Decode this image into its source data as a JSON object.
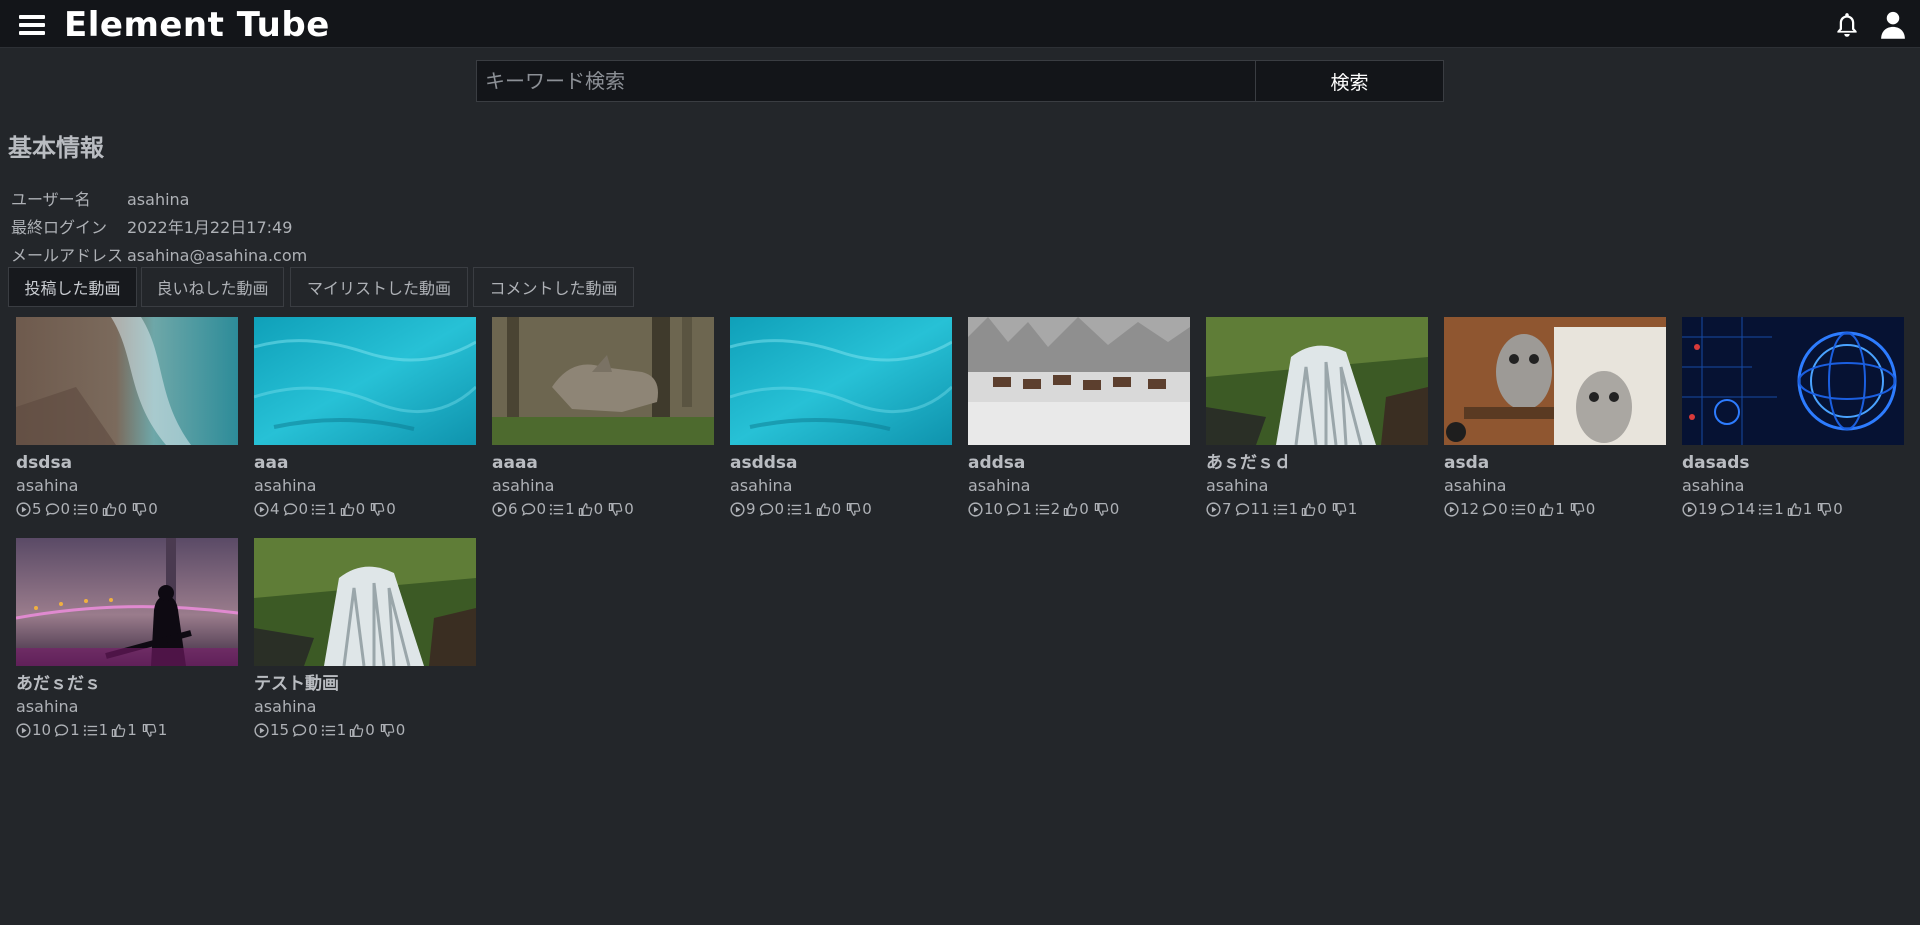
{
  "app": {
    "title": "Element Tube"
  },
  "header": {
    "menu_icon": "hamburger-menu-icon",
    "bell_icon": "bell-icon",
    "user_icon": "user-icon"
  },
  "search": {
    "placeholder": "キーワード検索",
    "value": "",
    "button_label": "検索"
  },
  "profile": {
    "section_title": "基本情報",
    "rows": [
      {
        "label": "ユーザー名",
        "value": "asahina"
      },
      {
        "label": "最終ログイン",
        "value": "2022年1月22日17:49"
      },
      {
        "label": "メールアドレス",
        "value": "asahina@asahina.com"
      }
    ]
  },
  "tabs": [
    {
      "label": "投稿した動画",
      "active": true
    },
    {
      "label": "良いねした動画",
      "active": false
    },
    {
      "label": "マイリストした動画",
      "active": false
    },
    {
      "label": "コメントした動画",
      "active": false
    }
  ],
  "videos": [
    {
      "title": "dsdsa",
      "author": "asahina",
      "plays": "5",
      "comments": "0",
      "mylists": "0",
      "likes": "0",
      "dislikes": "0",
      "thumb": "coast-aerial"
    },
    {
      "title": "aaa",
      "author": "asahina",
      "plays": "4",
      "comments": "0",
      "mylists": "1",
      "likes": "0",
      "dislikes": "0",
      "thumb": "turquoise-water"
    },
    {
      "title": "aaaa",
      "author": "asahina",
      "plays": "6",
      "comments": "0",
      "mylists": "1",
      "likes": "0",
      "dislikes": "0",
      "thumb": "wolf-forest"
    },
    {
      "title": "asddsa",
      "author": "asahina",
      "plays": "9",
      "comments": "0",
      "mylists": "1",
      "likes": "0",
      "dislikes": "0",
      "thumb": "turquoise-water"
    },
    {
      "title": "addsa",
      "author": "asahina",
      "plays": "10",
      "comments": "1",
      "mylists": "2",
      "likes": "0",
      "dislikes": "0",
      "thumb": "deer-snow"
    },
    {
      "title": "あｓだｓｄ",
      "author": "asahina",
      "plays": "7",
      "comments": "11",
      "mylists": "1",
      "likes": "0",
      "dislikes": "1",
      "thumb": "waterfall"
    },
    {
      "title": "asda",
      "author": "asahina",
      "plays": "12",
      "comments": "0",
      "mylists": "0",
      "likes": "1",
      "dislikes": "0",
      "thumb": "owls"
    },
    {
      "title": "dasads",
      "author": "asahina",
      "plays": "19",
      "comments": "14",
      "mylists": "1",
      "likes": "1",
      "dislikes": "0",
      "thumb": "tech-globe"
    },
    {
      "title": "あだｓだｓ",
      "author": "asahina",
      "plays": "10",
      "comments": "1",
      "mylists": "1",
      "likes": "1",
      "dislikes": "1",
      "thumb": "guitar-bridge"
    },
    {
      "title": "テスト動画",
      "author": "asahina",
      "plays": "15",
      "comments": "0",
      "mylists": "1",
      "likes": "0",
      "dislikes": "0",
      "thumb": "waterfall"
    }
  ]
}
